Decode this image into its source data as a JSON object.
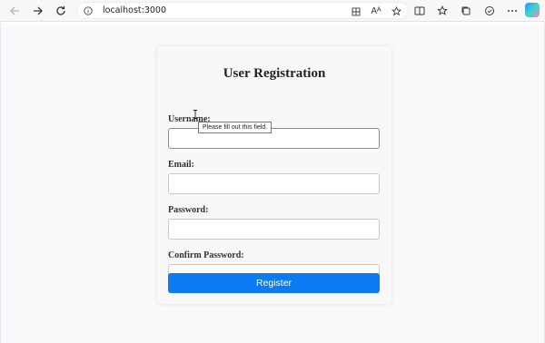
{
  "browser": {
    "url": "localhost:3000",
    "icons": [
      "back-icon",
      "forward-icon",
      "refresh-icon",
      "info-icon",
      "split-screen-icon",
      "read-aloud-icon",
      "favorite-icon",
      "split-tab-icon",
      "favorites-icon",
      "collections-icon",
      "extensions-icon",
      "more-icon",
      "copilot-icon"
    ],
    "read_aloud_label": "Aᴬ"
  },
  "form": {
    "title": "User Registration",
    "username_label": "Username:",
    "username_value": "",
    "email_label": "Email:",
    "email_value": "",
    "password_label": "Password:",
    "password_value": "",
    "confirm_label": "Confirm Password:",
    "confirm_value": "",
    "submit_label": "Register",
    "validation_tooltip": "Please fill out this field."
  },
  "colors": {
    "accent": "#0a7bf3",
    "focus_border": "#4a9be8"
  }
}
